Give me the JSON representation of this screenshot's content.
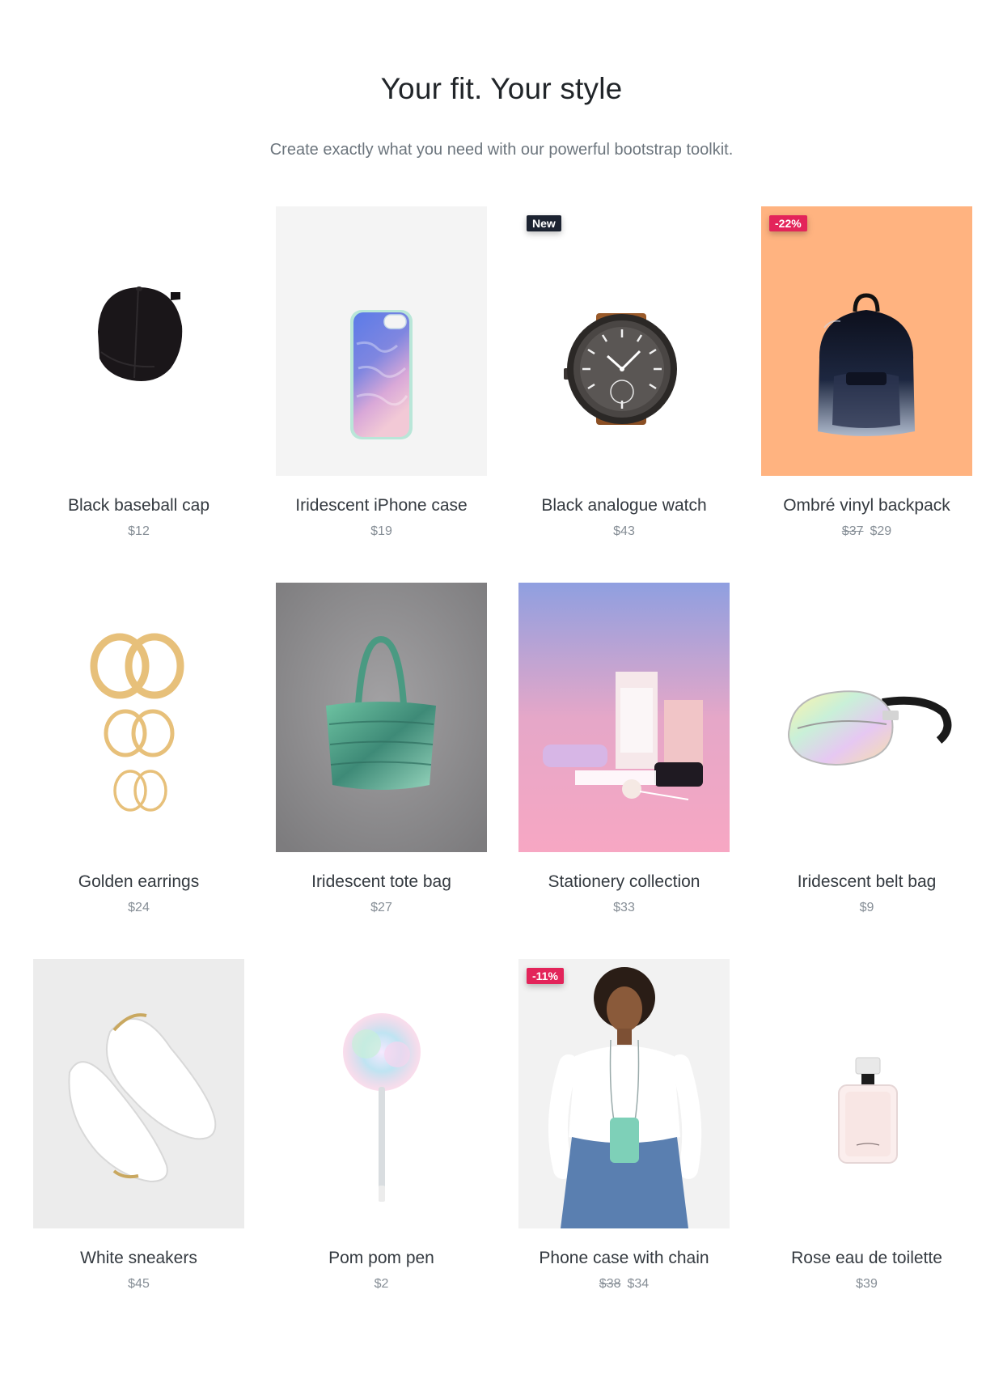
{
  "header": {
    "title": "Your fit. Your style",
    "subtitle": "Create exactly what you need with our powerful bootstrap toolkit."
  },
  "products": [
    {
      "name": "Black baseball cap",
      "price": "$12",
      "icon": "cap-icon"
    },
    {
      "name": "Iridescent iPhone case",
      "price": "$19",
      "icon": "phone-case-icon"
    },
    {
      "name": "Black analogue watch",
      "price": "$43",
      "badge": "New",
      "icon": "watch-icon"
    },
    {
      "name": "Ombré vinyl backpack",
      "old_price": "$37",
      "price": "$29",
      "badge": "-22%",
      "icon": "backpack-icon"
    },
    {
      "name": "Golden earrings",
      "price": "$24",
      "icon": "earrings-icon"
    },
    {
      "name": "Iridescent tote bag",
      "price": "$27",
      "icon": "tote-bag-icon"
    },
    {
      "name": "Stationery collection",
      "price": "$33",
      "icon": "stationery-icon"
    },
    {
      "name": "Iridescent belt bag",
      "price": "$9",
      "icon": "belt-bag-icon"
    },
    {
      "name": "White sneakers",
      "price": "$45",
      "icon": "sneakers-icon"
    },
    {
      "name": "Pom pom pen",
      "price": "$2",
      "icon": "pen-icon"
    },
    {
      "name": "Phone case with chain",
      "old_price": "$38",
      "price": "$34",
      "badge": "-11%",
      "icon": "model-with-phone-case-icon"
    },
    {
      "name": "Rose eau de toilette",
      "price": "$39",
      "icon": "perfume-icon"
    }
  ],
  "colors": {
    "badge_new": "#1c2331",
    "badge_sale": "#e3245a",
    "backpack_bg": "#ffb380"
  }
}
